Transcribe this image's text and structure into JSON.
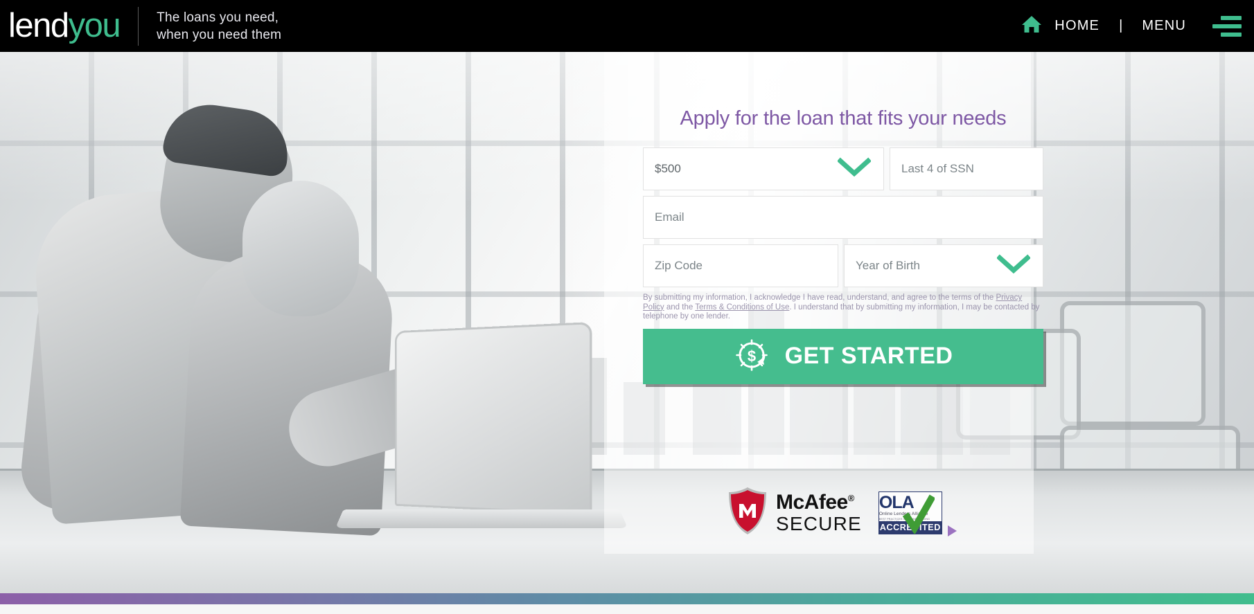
{
  "header": {
    "logo": {
      "part1": "lend",
      "part2": "you",
      "accent_color": "#3fbd8e"
    },
    "tagline_line1": "The loans you need,",
    "tagline_line2": "when you need them",
    "home_label": "HOME",
    "separator": "|",
    "menu_label": "MENU",
    "home_icon": "home-icon",
    "hamburger_icon": "hamburger-menu-icon",
    "background_color": "#000000"
  },
  "form": {
    "title": "Apply for the loan that fits your needs",
    "title_color": "#7d57a4",
    "loan_amount": {
      "value": "$500",
      "name": "loan-amount-select"
    },
    "ssn": {
      "placeholder": "Last 4 of SSN",
      "value": ""
    },
    "email": {
      "placeholder": "Email",
      "value": ""
    },
    "zip": {
      "placeholder": "Zip Code",
      "value": ""
    },
    "year_of_birth": {
      "placeholder": "Year of Birth",
      "value": ""
    },
    "disclaimer": {
      "part1": "By submitting my information, I acknowledge I have read, understand, and agree to the terms of the ",
      "link1": "Privacy Policy",
      "part2": " and the ",
      "link2": "Terms & Conditions of Use",
      "part3": ". I understand that by submitting my information, I may be contacted by telephone by one lender."
    },
    "cta": {
      "label": "GET STARTED",
      "color": "#45bd8e",
      "icon": "dollar-clock-icon"
    }
  },
  "badges": {
    "mcafee": {
      "line1": "McAfee",
      "registered": "®",
      "line2": "SECURE",
      "shield_color": "#c8102e",
      "letter": "M"
    },
    "ola": {
      "main": "OLA",
      "sub": "Online Lenders Alliance",
      "tiny": "BEST PRACTICES IN ONLINE LENDING MARKETPLACE",
      "band": "ACCREDITED",
      "check_color": "#3f9c35",
      "arrow_color": "#9b72c0"
    }
  },
  "footer": {
    "gradient_from": "#8c5fa8",
    "gradient_to": "#41bd8d"
  }
}
